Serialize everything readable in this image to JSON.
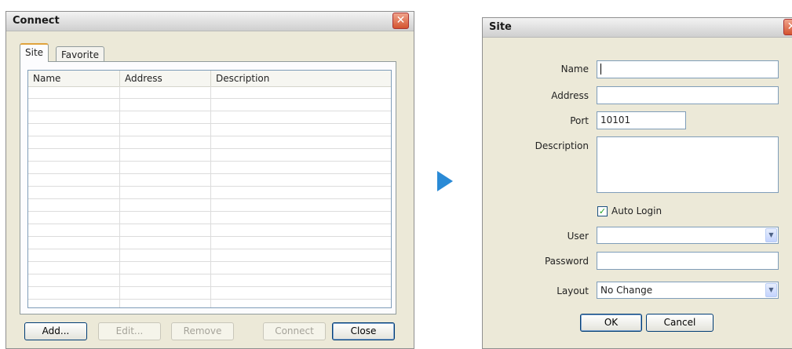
{
  "connect_dialog": {
    "title": "Connect",
    "tabs": [
      {
        "label": "Site"
      },
      {
        "label": "Favorite"
      }
    ],
    "columns": [
      "Name",
      "Address",
      "Description"
    ],
    "buttons": {
      "add": "Add...",
      "edit": "Edit...",
      "remove": "Remove",
      "connect": "Connect",
      "close": "Close"
    }
  },
  "site_dialog": {
    "title": "Site",
    "fields": {
      "name_label": "Name",
      "name_value": "",
      "address_label": "Address",
      "address_value": "",
      "port_label": "Port",
      "port_value": "10101",
      "description_label": "Description",
      "description_value": "",
      "auto_login_label": "Auto Login",
      "auto_login_checked": true,
      "user_label": "User",
      "user_value": "",
      "password_label": "Password",
      "password_value": "",
      "layout_label": "Layout",
      "layout_value": "No Change"
    },
    "buttons": {
      "ok": "OK",
      "cancel": "Cancel"
    }
  },
  "colors": {
    "dialog_bg": "#ece9d8",
    "close_button": "#d4532f",
    "arrow": "#2a8ad6",
    "active_tab_accent": "#e0a33d"
  }
}
